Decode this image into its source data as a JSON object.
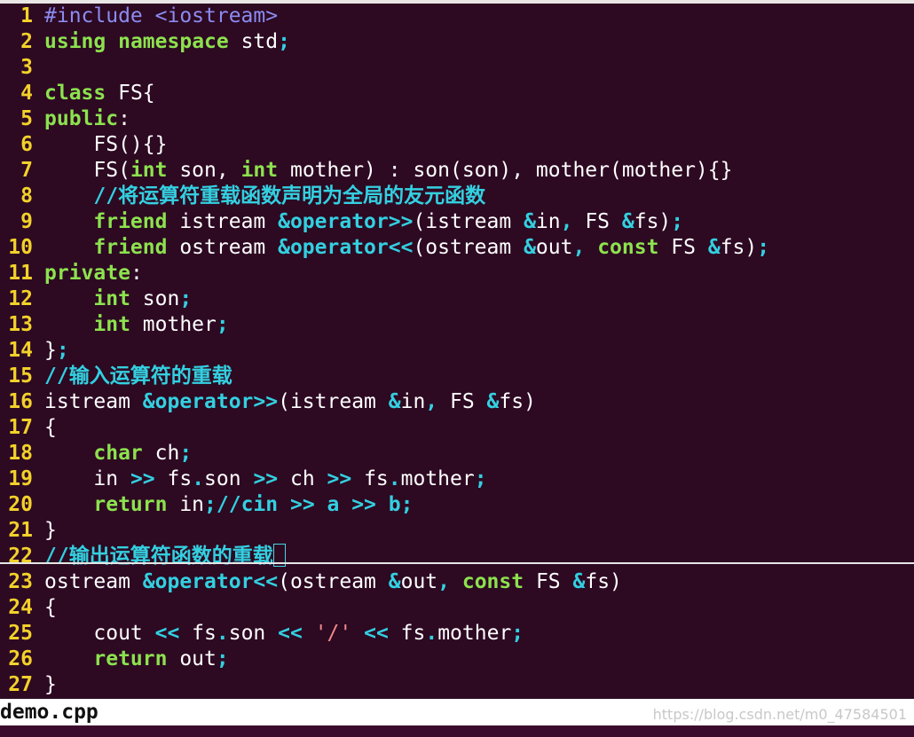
{
  "editor": {
    "lines": [
      {
        "n": "1",
        "tokens": [
          [
            "pre",
            "#include <iostream>"
          ]
        ]
      },
      {
        "n": "2",
        "tokens": [
          [
            "kw",
            "using"
          ],
          [
            "txt",
            " "
          ],
          [
            "kw",
            "namespace"
          ],
          [
            "txt",
            " std"
          ],
          [
            "op",
            ";"
          ]
        ]
      },
      {
        "n": "3",
        "tokens": []
      },
      {
        "n": "4",
        "tokens": [
          [
            "kw",
            "class"
          ],
          [
            "txt",
            " FS{"
          ]
        ]
      },
      {
        "n": "5",
        "tokens": [
          [
            "kw",
            "public"
          ],
          [
            "txt",
            ":"
          ]
        ]
      },
      {
        "n": "6",
        "tokens": [
          [
            "txt",
            "    FS(){}"
          ]
        ]
      },
      {
        "n": "7",
        "tokens": [
          [
            "txt",
            "    FS("
          ],
          [
            "kw",
            "int"
          ],
          [
            "txt",
            " son, "
          ],
          [
            "kw",
            "int"
          ],
          [
            "txt",
            " mother) : son(son), mother(mother){}"
          ]
        ]
      },
      {
        "n": "8",
        "tokens": [
          [
            "txt",
            "    "
          ],
          [
            "cm",
            "//将运算符重载函数声明为全局的友元函数"
          ]
        ]
      },
      {
        "n": "9",
        "tokens": [
          [
            "txt",
            "    "
          ],
          [
            "kw",
            "friend"
          ],
          [
            "txt",
            " istream "
          ],
          [
            "op",
            "&operator>>"
          ],
          [
            "txt",
            "(istream "
          ],
          [
            "op",
            "&"
          ],
          [
            "txt",
            "in"
          ],
          [
            "op",
            ","
          ],
          [
            "txt",
            " FS "
          ],
          [
            "op",
            "&"
          ],
          [
            "txt",
            "fs)"
          ],
          [
            "op",
            ";"
          ]
        ]
      },
      {
        "n": "10",
        "tokens": [
          [
            "txt",
            "    "
          ],
          [
            "kw",
            "friend"
          ],
          [
            "txt",
            " ostream "
          ],
          [
            "op",
            "&operator<<"
          ],
          [
            "txt",
            "(ostream "
          ],
          [
            "op",
            "&"
          ],
          [
            "txt",
            "out"
          ],
          [
            "op",
            ","
          ],
          [
            "txt",
            " "
          ],
          [
            "kw",
            "const"
          ],
          [
            "txt",
            " FS "
          ],
          [
            "op",
            "&"
          ],
          [
            "txt",
            "fs)"
          ],
          [
            "op",
            ";"
          ]
        ]
      },
      {
        "n": "11",
        "tokens": [
          [
            "kw",
            "private"
          ],
          [
            "txt",
            ":"
          ]
        ]
      },
      {
        "n": "12",
        "tokens": [
          [
            "txt",
            "    "
          ],
          [
            "kw",
            "int"
          ],
          [
            "txt",
            " son"
          ],
          [
            "op",
            ";"
          ]
        ]
      },
      {
        "n": "13",
        "tokens": [
          [
            "txt",
            "    "
          ],
          [
            "kw",
            "int"
          ],
          [
            "txt",
            " mother"
          ],
          [
            "op",
            ";"
          ]
        ]
      },
      {
        "n": "14",
        "tokens": [
          [
            "txt",
            "}"
          ],
          [
            "op",
            ";"
          ]
        ]
      },
      {
        "n": "15",
        "tokens": [
          [
            "cm",
            "//输入运算符的重载"
          ]
        ]
      },
      {
        "n": "16",
        "tokens": [
          [
            "txt",
            "istream "
          ],
          [
            "op",
            "&operator>>"
          ],
          [
            "txt",
            "(istream "
          ],
          [
            "op",
            "&"
          ],
          [
            "txt",
            "in"
          ],
          [
            "op",
            ","
          ],
          [
            "txt",
            " FS "
          ],
          [
            "op",
            "&"
          ],
          [
            "txt",
            "fs)"
          ]
        ]
      },
      {
        "n": "17",
        "tokens": [
          [
            "txt",
            "{"
          ]
        ]
      },
      {
        "n": "18",
        "tokens": [
          [
            "txt",
            "    "
          ],
          [
            "kw",
            "char"
          ],
          [
            "txt",
            " ch"
          ],
          [
            "op",
            ";"
          ]
        ]
      },
      {
        "n": "19",
        "tokens": [
          [
            "txt",
            "    in "
          ],
          [
            "op",
            ">>"
          ],
          [
            "txt",
            " fs"
          ],
          [
            "op",
            "."
          ],
          [
            "txt",
            "son "
          ],
          [
            "op",
            ">>"
          ],
          [
            "txt",
            " ch "
          ],
          [
            "op",
            ">>"
          ],
          [
            "txt",
            " fs"
          ],
          [
            "op",
            "."
          ],
          [
            "txt",
            "mother"
          ],
          [
            "op",
            ";"
          ]
        ]
      },
      {
        "n": "20",
        "tokens": [
          [
            "txt",
            "    "
          ],
          [
            "kw",
            "return"
          ],
          [
            "txt",
            " in"
          ],
          [
            "op",
            ";"
          ],
          [
            "cm",
            "//cin >> a >> b;"
          ]
        ]
      },
      {
        "n": "21",
        "tokens": [
          [
            "txt",
            "}"
          ]
        ]
      },
      {
        "n": "22",
        "tokens": [
          [
            "cm",
            "//输出运算符函数的重载"
          ]
        ],
        "cursor": true
      },
      {
        "n": "23",
        "tokens": [
          [
            "txt",
            "ostream "
          ],
          [
            "op",
            "&operator<<"
          ],
          [
            "txt",
            "(ostream "
          ],
          [
            "op",
            "&"
          ],
          [
            "txt",
            "out"
          ],
          [
            "op",
            ","
          ],
          [
            "txt",
            " "
          ],
          [
            "kw",
            "const"
          ],
          [
            "txt",
            " FS "
          ],
          [
            "op",
            "&"
          ],
          [
            "txt",
            "fs)"
          ]
        ]
      },
      {
        "n": "24",
        "tokens": [
          [
            "txt",
            "{"
          ]
        ]
      },
      {
        "n": "25",
        "tokens": [
          [
            "txt",
            "    cout "
          ],
          [
            "op",
            "<<"
          ],
          [
            "txt",
            " fs"
          ],
          [
            "op",
            "."
          ],
          [
            "txt",
            "son "
          ],
          [
            "op",
            "<<"
          ],
          [
            "txt",
            " "
          ],
          [
            "str",
            "'/'"
          ],
          [
            "txt",
            " "
          ],
          [
            "op",
            "<<"
          ],
          [
            "txt",
            " fs"
          ],
          [
            "op",
            "."
          ],
          [
            "txt",
            "mother"
          ],
          [
            "op",
            ";"
          ]
        ]
      },
      {
        "n": "26",
        "tokens": [
          [
            "txt",
            "    "
          ],
          [
            "kw",
            "return"
          ],
          [
            "txt",
            " out"
          ],
          [
            "op",
            ";"
          ]
        ]
      },
      {
        "n": "27",
        "tokens": [
          [
            "txt",
            "}"
          ]
        ]
      }
    ]
  },
  "statusbar": {
    "filename": "demo.cpp",
    "watermark": "https://blog.csdn.net/m0_47584501"
  },
  "colors": {
    "background": "#2d0922",
    "line_number": "#f2d12a",
    "keyword": "#8ce24e",
    "operator": "#33d0e0",
    "comment": "#33d0e0",
    "preprocessor": "#8b8cf0",
    "string": "#f08a8a",
    "text": "#ffffff"
  }
}
